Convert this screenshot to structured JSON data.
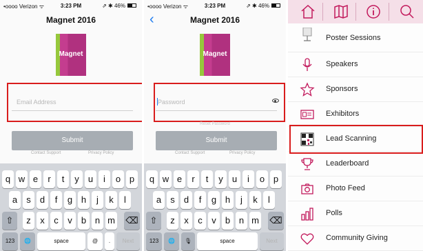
{
  "status": {
    "carrier": "•oooo Verizon ᯤ",
    "time": "3:23 PM",
    "right": "⇗ ✱ 46%"
  },
  "app": {
    "title": "Magnet 2016",
    "logo_text": "Magnet"
  },
  "login": {
    "email_placeholder": "Email Address",
    "password_placeholder": "Password",
    "reset_password": "Reset Password",
    "submit": "Submit",
    "contact_support": "Contact Support",
    "privacy_policy": "Privacy Policy"
  },
  "keyboard": {
    "row1": [
      "q",
      "w",
      "e",
      "r",
      "t",
      "y",
      "u",
      "i",
      "o",
      "p"
    ],
    "row2": [
      "a",
      "s",
      "d",
      "f",
      "g",
      "h",
      "j",
      "k",
      "l"
    ],
    "row3": [
      "z",
      "x",
      "c",
      "v",
      "b",
      "n",
      "m"
    ],
    "shift": "⇧",
    "delete": "⌫",
    "numbers": "123",
    "globe": "🌐",
    "mic": "🎙",
    "space": "space",
    "at": "@",
    "dot": ".",
    "next": "Next"
  },
  "menu": {
    "items": [
      {
        "label": "Poster Sessions",
        "icon": "poster-icon"
      },
      {
        "label": "Speakers",
        "icon": "microphone-icon"
      },
      {
        "label": "Sponsors",
        "icon": "star-icon"
      },
      {
        "label": "Exhibitors",
        "icon": "id-card-icon"
      },
      {
        "label": "Lead Scanning",
        "icon": "qr-code-icon"
      },
      {
        "label": "Leaderboard",
        "icon": "trophy-icon"
      },
      {
        "label": "Photo Feed",
        "icon": "camera-icon"
      },
      {
        "label": "Polls",
        "icon": "bar-chart-icon"
      },
      {
        "label": "Community Giving",
        "icon": "heart-icon"
      }
    ]
  },
  "colors": {
    "highlight_border": "#d91c1c",
    "menu_accent": "#c2185b",
    "topbar_bg": "#f5dfe8",
    "submit_bg": "#a7adb3",
    "back_chevron": "#1e7cf0"
  }
}
